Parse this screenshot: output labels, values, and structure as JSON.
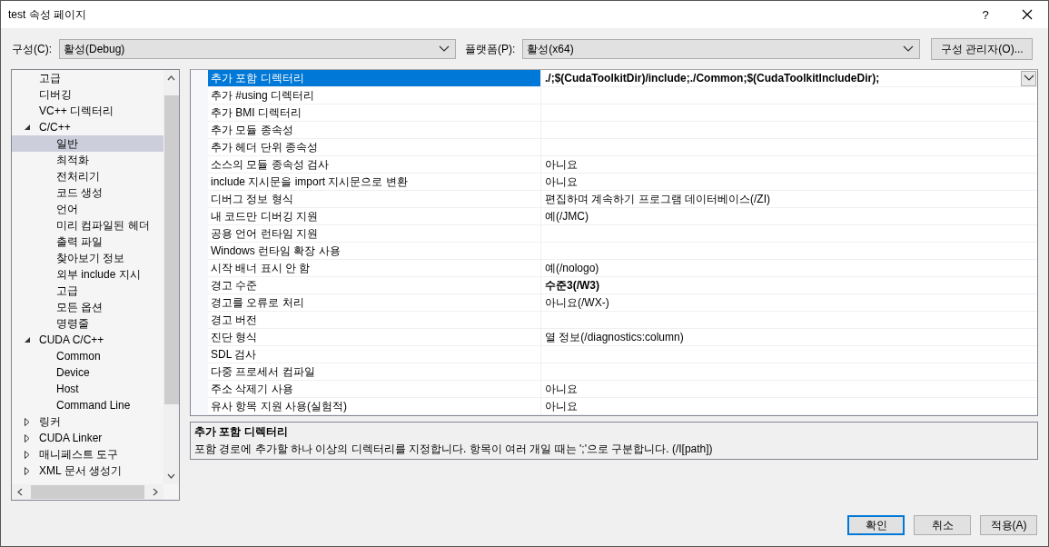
{
  "window": {
    "title": "test 속성 페이지",
    "help": "?"
  },
  "toolbar": {
    "configuration": {
      "label": "구성(C):",
      "value": "활성(Debug)"
    },
    "platform": {
      "label": "플랫폼(P):",
      "value": "활성(x64)"
    },
    "manager_button": "구성 관리자(O)..."
  },
  "tree": {
    "items": [
      {
        "label": "고급",
        "selected": false
      },
      {
        "label": "디버깅",
        "selected": false
      },
      {
        "label": "VC++ 디렉터리",
        "selected": false
      },
      {
        "label": "C/C++",
        "selected": false,
        "expanded": true,
        "children": [
          {
            "label": "일반",
            "selected": true
          },
          {
            "label": "최적화",
            "selected": false
          },
          {
            "label": "전처리기",
            "selected": false
          },
          {
            "label": "코드 생성",
            "selected": false
          },
          {
            "label": "언어",
            "selected": false
          },
          {
            "label": "미리 컴파일된 헤더",
            "selected": false
          },
          {
            "label": "출력 파일",
            "selected": false
          },
          {
            "label": "찾아보기 정보",
            "selected": false
          },
          {
            "label": "외부 include 지시",
            "selected": false
          },
          {
            "label": "고급",
            "selected": false
          },
          {
            "label": "모든 옵션",
            "selected": false
          },
          {
            "label": "명령줄",
            "selected": false
          }
        ]
      },
      {
        "label": "CUDA C/C++",
        "selected": false,
        "expanded": true,
        "children": [
          {
            "label": "Common",
            "selected": false
          },
          {
            "label": "Device",
            "selected": false
          },
          {
            "label": "Host",
            "selected": false
          },
          {
            "label": "Command Line",
            "selected": false
          }
        ]
      },
      {
        "label": "링커",
        "selected": false,
        "expanded": false
      },
      {
        "label": "CUDA Linker",
        "selected": false,
        "expanded": false
      },
      {
        "label": "매니페스트 도구",
        "selected": false,
        "expanded": false
      },
      {
        "label": "XML 문서 생성기",
        "selected": false,
        "expanded": false
      }
    ]
  },
  "grid": {
    "rows": [
      {
        "name": "추가 포함 디렉터리",
        "value": "./;$(CudaToolkitDir)/include;./Common;$(CudaToolkitIncludeDir);",
        "bold": true,
        "selected": true
      },
      {
        "name": "추가 #using 디렉터리",
        "selected": false
      },
      {
        "name": "추가 BMI 디렉터리",
        "selected": false
      },
      {
        "name": "추가 모듈 종속성",
        "selected": false
      },
      {
        "name": "추가 헤더 단위 종속성",
        "selected": false
      },
      {
        "name": "소스의 모듈 종속성 검사",
        "value": "아니요",
        "selected": false
      },
      {
        "name": "include 지시문을 import 지시문으로 변환",
        "value": "아니요",
        "selected": false
      },
      {
        "name": "디버그 정보 형식",
        "value": "편집하며 계속하기 프로그램 데이터베이스(/ZI)",
        "selected": false
      },
      {
        "name": "내 코드만 디버깅 지원",
        "value": "예(/JMC)",
        "selected": false
      },
      {
        "name": "공용 언어 런타임 지원",
        "selected": false
      },
      {
        "name": "Windows 런타임 확장 사용",
        "selected": false
      },
      {
        "name": "시작 배너 표시 안 함",
        "value": "예(/nologo)",
        "selected": false
      },
      {
        "name": "경고 수준",
        "value": "수준3(/W3)",
        "bold": true,
        "selected": false
      },
      {
        "name": "경고를 오류로 처리",
        "value": "아니요(/WX-)",
        "selected": false
      },
      {
        "name": "경고 버전",
        "selected": false
      },
      {
        "name": "진단 형식",
        "value": "열 정보(/diagnostics:column)",
        "selected": false
      },
      {
        "name": "SDL 검사",
        "selected": false
      },
      {
        "name": "다중 프로세서 컴파일",
        "selected": false
      },
      {
        "name": "주소 삭제기 사용",
        "value": "아니요",
        "selected": false
      },
      {
        "name": "유사 항목 지원 사용(실험적)",
        "value": "아니요",
        "selected": false
      }
    ]
  },
  "description": {
    "title": "추가 포함 디렉터리",
    "text": "포함 경로에 추가할 하나 이상의 디렉터리를 지정합니다. 항목이 여러 개일 때는 ';'으로 구분합니다. (/I[path])"
  },
  "buttons": [
    {
      "label": "확인",
      "default": true
    },
    {
      "label": "취소",
      "default": false
    },
    {
      "label": "적용(A)",
      "default": false
    }
  ]
}
